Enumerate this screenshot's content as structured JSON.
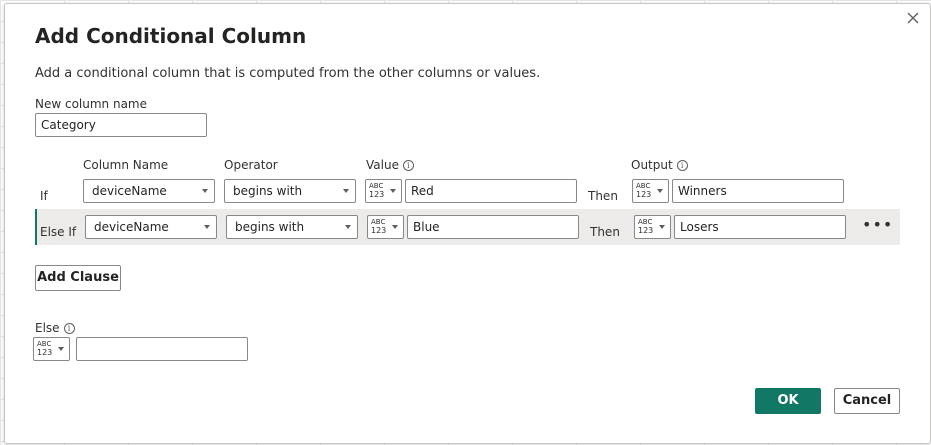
{
  "dialog": {
    "title": "Add Conditional Column",
    "subtitle": "Add a conditional column that is computed from the other columns or values."
  },
  "new_column": {
    "label": "New column name",
    "value": "Category"
  },
  "headers": {
    "column_name": "Column Name",
    "operator": "Operator",
    "value": "Value",
    "output": "Output",
    "info_glyph": "i"
  },
  "type_badge": {
    "abc": "ABC",
    "num": "123"
  },
  "clauses": [
    {
      "prefix": "If",
      "column": "deviceName",
      "operator": "begins with",
      "value": "Red",
      "then": "Then",
      "output": "Winners"
    },
    {
      "prefix": "Else If",
      "column": "deviceName",
      "operator": "begins with",
      "value": "Blue",
      "then": "Then",
      "output": "Losers",
      "more": "•••"
    }
  ],
  "add_clause_label": "Add Clause",
  "else": {
    "label": "Else",
    "value": ""
  },
  "buttons": {
    "ok": "OK",
    "cancel": "Cancel"
  },
  "colors": {
    "accent": "#117865"
  }
}
